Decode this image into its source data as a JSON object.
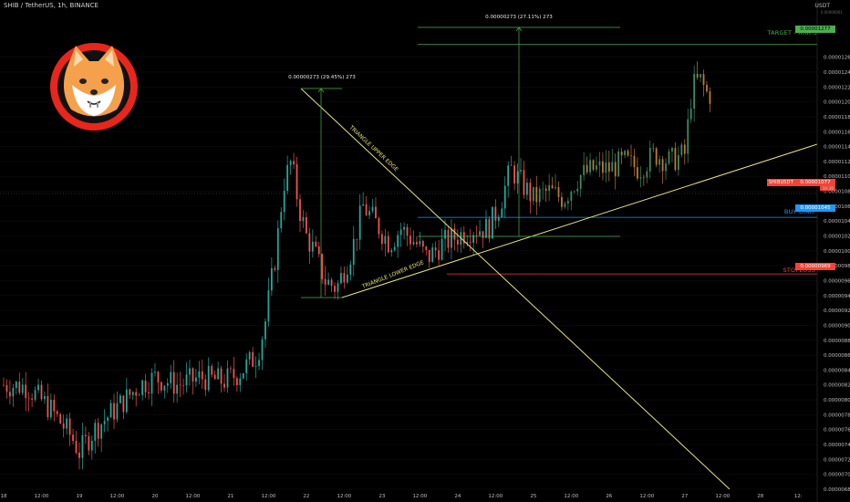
{
  "header": {
    "title": "SHIB / TetherUS, 1h, BINANCE"
  },
  "axis": {
    "unit": "USDT",
    "unit_sub": "0.00000001"
  },
  "colors": {
    "up": "#26a69a",
    "down": "#ef5350",
    "pump": "#c07a30",
    "triangle": "#e8e27a",
    "measure": "#4caf50",
    "target": "#4caf50",
    "buy": "#2196f3",
    "stop": "#f44336",
    "logo_red": "#e8261c",
    "logo_orange": "#f5a04a"
  },
  "logo": {
    "name": "shiba-inu-logo"
  },
  "chart_data": {
    "type": "candlestick",
    "title": "SHIB / TetherUS, 1h, BINANCE",
    "ylim": [
      6.8e-06,
      1.3e-05
    ],
    "y_ticks": [
      "0.00001260",
      "0.00001240",
      "0.00001220",
      "0.00001200",
      "0.00001180",
      "0.00001160",
      "0.00001140",
      "0.00001120",
      "0.00001100",
      "0.00001080",
      "0.00001060",
      "0.00001040",
      "0.00001020",
      "0.00001000",
      "0.00000980",
      "0.00000960",
      "0.00000940",
      "0.00000920",
      "0.00000900",
      "0.00000880",
      "0.00000860",
      "0.00000840",
      "0.00000820",
      "0.00000800",
      "0.00000780",
      "0.00000760",
      "0.00000740",
      "0.00000720",
      "0.00000700",
      "0.00000680"
    ],
    "x_ticks": [
      "18",
      "12:00",
      "19",
      "12:00",
      "20",
      "12:00",
      "21",
      "12:00",
      "22",
      "12:00",
      "23",
      "12:00",
      "24",
      "12:00",
      "25",
      "12:00",
      "26",
      "12:00",
      "27",
      "12:00",
      "28",
      "12:"
    ],
    "x_start": 18.0,
    "x_end": 28.75,
    "close_path": [
      [
        18.0,
        8.2e-06
      ],
      [
        18.3,
        8.18e-06
      ],
      [
        18.6,
        7.9e-06
      ],
      [
        18.9,
        7.5e-06
      ],
      [
        19.0,
        7.3e-06
      ],
      [
        19.2,
        7.6e-06
      ],
      [
        19.5,
        7.9e-06
      ],
      [
        19.8,
        8.2e-06
      ],
      [
        20.0,
        8.3e-06
      ],
      [
        20.3,
        8.2e-06
      ],
      [
        20.6,
        8.3e-06
      ],
      [
        20.9,
        8.25e-06
      ],
      [
        21.1,
        8.35e-06
      ],
      [
        21.35,
        8.6e-06
      ],
      [
        21.45,
        9e-06
      ],
      [
        21.6,
        1e-05
      ],
      [
        21.7,
        1.09e-05
      ],
      [
        21.8,
        1.12e-05
      ],
      [
        21.9,
        1.06e-05
      ],
      [
        22.0,
        1.02e-05
      ],
      [
        22.1,
        1e-05
      ],
      [
        22.25,
        9.6e-06
      ],
      [
        22.4,
        9.5e-06
      ],
      [
        22.6,
        1e-05
      ],
      [
        22.75,
        1.06e-05
      ],
      [
        22.9,
        1.04e-05
      ],
      [
        23.1,
        1.01e-05
      ],
      [
        23.25,
        1.03e-05
      ],
      [
        23.45,
        1.01e-05
      ],
      [
        23.6,
        9.9e-06
      ],
      [
        23.8,
        1.01e-05
      ],
      [
        24.0,
        1.02e-05
      ],
      [
        24.2,
        1.03e-05
      ],
      [
        24.4,
        1.03e-05
      ],
      [
        24.55,
        1.06e-05
      ],
      [
        24.7,
        1.11e-05
      ],
      [
        24.85,
        1.09e-05
      ],
      [
        25.0,
        1.07e-05
      ],
      [
        25.2,
        1.08e-05
      ],
      [
        25.4,
        1.07e-05
      ],
      [
        25.6,
        1.1e-05
      ],
      [
        25.8,
        1.11e-05
      ],
      [
        26.0,
        1.11e-05
      ],
      [
        26.2,
        1.12e-05
      ],
      [
        26.4,
        1.11e-05
      ],
      [
        26.6,
        1.13e-05
      ],
      [
        26.8,
        1.12e-05
      ],
      [
        27.0,
        1.13e-05
      ],
      [
        27.1,
        1.22e-05
      ],
      [
        27.2,
        1.23e-05
      ],
      [
        27.3,
        1.21e-05
      ]
    ],
    "annotations": {
      "measure_left": {
        "label": "0.00000273 (29.45%) 273"
      },
      "measure_right": {
        "label": "0.00000273 (27.11%) 273"
      },
      "triangle_upper": {
        "label": "TRIANGLE UPPER EDGE"
      },
      "triangle_lower": {
        "label": "TRIANGLE LOWER EDGE"
      }
    },
    "levels": {
      "target": {
        "label": "TARGET - RRR 3",
        "price": "0.00001277",
        "value": 1.277e-05
      },
      "current": {
        "label": "SHIBUSDT",
        "price": "0.00001077",
        "sub": "39:39",
        "value": 1.077e-05
      },
      "buy": {
        "label": "BUY LIMIT",
        "price": "0.00001045",
        "value": 1.045e-05
      },
      "stop": {
        "label": "STOPLOSS",
        "price": "0.00000969",
        "value": 9.69e-06
      }
    }
  }
}
